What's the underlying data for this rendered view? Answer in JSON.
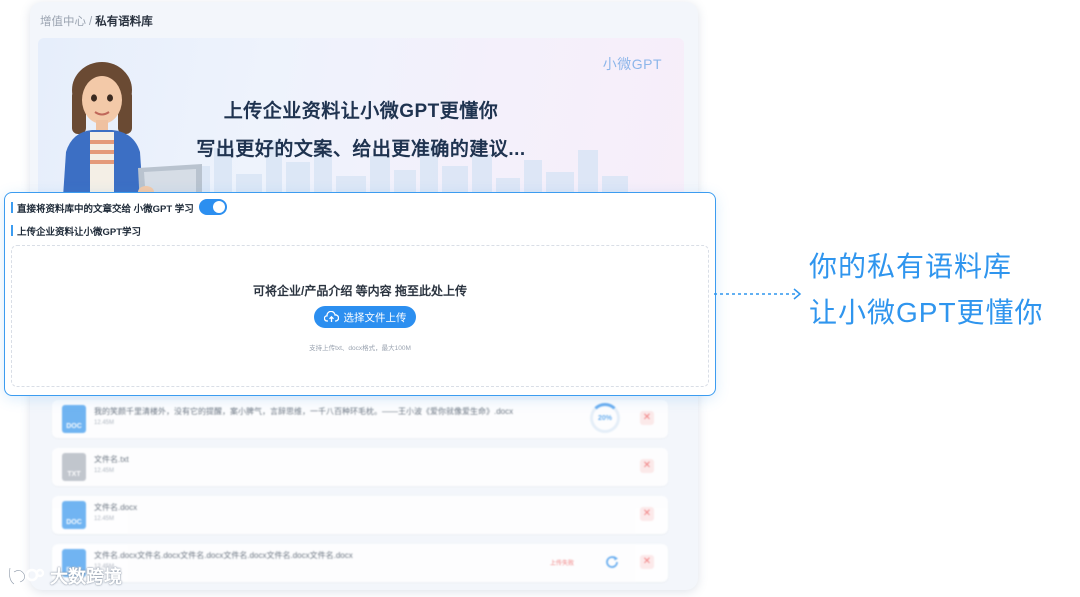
{
  "breadcrumb": {
    "parent": "增值中心",
    "separator": "/",
    "current": "私有语料库"
  },
  "banner": {
    "brand": "小微GPT",
    "line1": "上传企业资料让小微GPT更懂你",
    "line2": "写出更好的文案、给出更准确的建议..."
  },
  "settings": {
    "toggle_label": "直接将资料库中的文章交给 小微GPT 学习",
    "toggle_on": true,
    "upload_section_title": "上传企业资料让小微GPT学习"
  },
  "dropzone": {
    "hint": "可将企业/产品介绍 等内容 拖至此处上传",
    "button_label": "选择文件上传",
    "note": "支持上传txt、docx格式，最大100M"
  },
  "files": [
    {
      "type": "DOC",
      "name": "我的笑颜千里清楼外，没有它的提醒，案小脾气，言辞思维，一千八百种环毛枕。——王小波《爱你就像爱生命》.docx",
      "size": "12.45M",
      "progress": "20%",
      "delete": "✕"
    },
    {
      "type": "TXT",
      "name": "文件名.txt",
      "size": "12.45M",
      "delete": "✕"
    },
    {
      "type": "DOC",
      "name": "文件名.docx",
      "size": "12.45M",
      "delete": "✕"
    },
    {
      "type": "DOC",
      "name": "文件名.docx文件名.docx文件名.docx文件名.docx文件名.docx文件名.docx",
      "size": "12.45M",
      "status": "上传失败",
      "delete": "✕"
    }
  ],
  "callout": {
    "line1": "你的私有语料库",
    "line2": "让小微GPT更懂你"
  },
  "watermark": {
    "text": "大数跨境"
  },
  "colors": {
    "accent": "#2c8ff0",
    "callout": "#2f95ee",
    "danger": "#f06d6d"
  }
}
